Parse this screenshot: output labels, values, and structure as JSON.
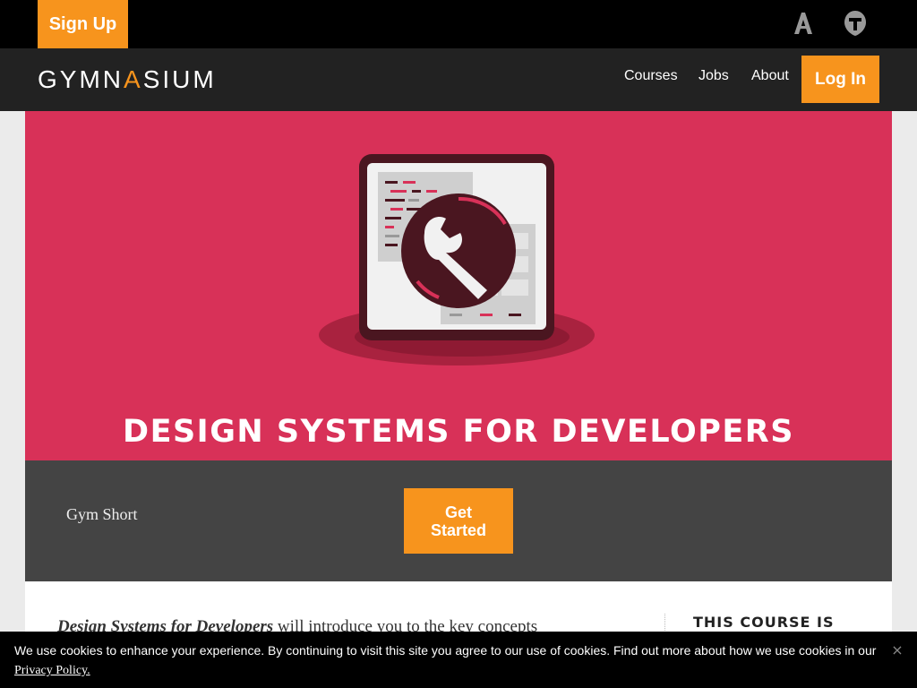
{
  "topbar": {
    "signup_label": "Sign Up",
    "icons": [
      "aquent-logo-icon",
      "vitamin-t-icon"
    ]
  },
  "nav": {
    "logo_pre": "GYMN",
    "logo_a": "A",
    "logo_post": "SIUM",
    "links": [
      "Courses",
      "Jobs",
      "About"
    ],
    "login_label": "Log In"
  },
  "hero": {
    "title": "DESIGN SYSTEMS FOR DEVELOPERS",
    "illustration": "wrench-on-browser-window-icon",
    "background_color": "#d83158"
  },
  "infobar": {
    "type_label": "Gym Short",
    "cta_label": "Get Started"
  },
  "content": {
    "intro_title": "Design Systems for Developers",
    "intro_text": " will introduce you to the key concepts",
    "aside_heading": "THIS COURSE IS"
  },
  "cookie_banner": {
    "text": "We use cookies to enhance your experience. By continuing to visit this site you agree to our use of cookies. Find out more about how we use cookies in our ",
    "link_label": "Privacy Policy.",
    "close_label": "×"
  },
  "colors": {
    "accent": "#f7941d",
    "hero": "#d83158",
    "dark": "#222222"
  }
}
